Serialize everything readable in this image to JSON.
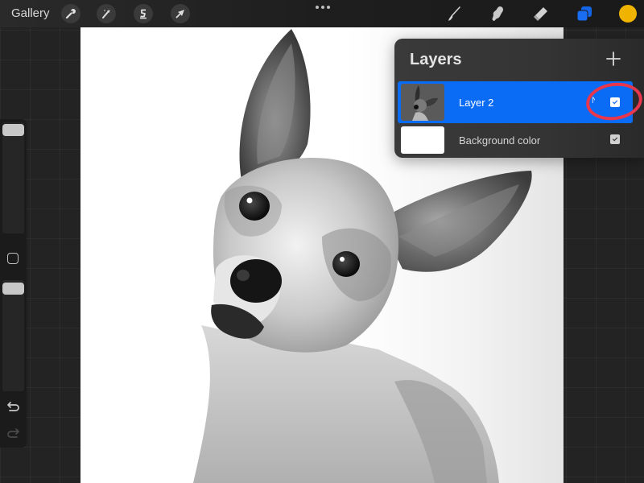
{
  "topbar": {
    "gallery_label": "Gallery",
    "left_tools": [
      {
        "name": "actions",
        "icon": "wrench-icon"
      },
      {
        "name": "adjustments",
        "icon": "magic-wand-icon"
      },
      {
        "name": "selection",
        "icon": "selection-s-icon"
      },
      {
        "name": "transform",
        "icon": "arrow-cursor-icon"
      }
    ],
    "more_icon": "more-dots-icon",
    "right_tools": [
      {
        "name": "brush",
        "icon": "brush-icon"
      },
      {
        "name": "smudge",
        "icon": "smudge-finger-icon"
      },
      {
        "name": "eraser",
        "icon": "eraser-icon"
      },
      {
        "name": "layers",
        "icon": "layers-icon",
        "active": true
      }
    ],
    "current_color": "#f0b400",
    "layers_accent": "#1a6cf0"
  },
  "sidebar": {
    "brush_size": 0,
    "brush_opacity": 0,
    "modify_icon": "square-modify-icon",
    "undo_icon": "undo-icon",
    "redo_icon": "redo-icon"
  },
  "canvas": {
    "content": "Grayscale painting of a chihuahua-type dog with large ears, head tilted"
  },
  "layers_panel": {
    "title": "Layers",
    "add_icon": "plus-icon",
    "layers": [
      {
        "name": "Layer 2",
        "blend_mode": "N",
        "visible": true,
        "selected": true
      },
      {
        "name": "Background color",
        "visible": true,
        "selected": false
      }
    ]
  },
  "annotation": {
    "color": "#e8364c",
    "target": "Layer 2 visibility checkbox"
  }
}
